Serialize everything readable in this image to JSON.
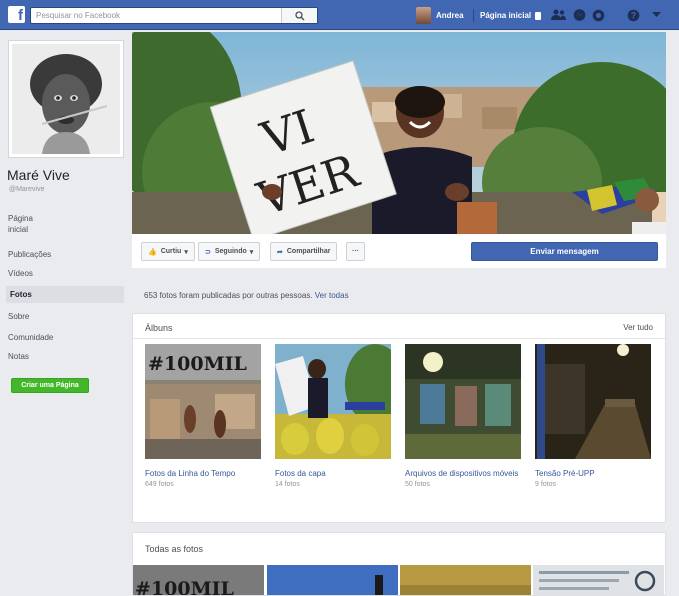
{
  "topbar": {
    "search_placeholder": "Pesquisar no Facebook",
    "logo": "f",
    "user_name": "Andrea",
    "home_label": "Página inicial",
    "icons": [
      "friends-icon",
      "messages-icon",
      "notifications-icon",
      "help-icon",
      "dropdown-icon"
    ],
    "brand_color": "#4267b2"
  },
  "page": {
    "name": "Maré Vive",
    "handle": "@Marevive"
  },
  "nav": {
    "items": [
      {
        "label": "Página inicial"
      },
      {
        "label": "Publicações"
      },
      {
        "label": "Vídeos"
      },
      {
        "label": "Fotos",
        "active": true
      },
      {
        "label": "Sobre"
      },
      {
        "label": "Comunidade"
      },
      {
        "label": "Notas"
      }
    ],
    "create_page_label": "Criar uma Página"
  },
  "cover": {
    "sign_text_line1": "VI",
    "sign_text_line2": "VER"
  },
  "actions": {
    "like_label": "Curtiu",
    "follow_label": "Seguindo",
    "share_label": "Compartilhar",
    "more_label": "···",
    "message_label": "Enviar mensagem"
  },
  "photos_info": {
    "text": "653 fotos foram publicadas por outras pessoas.",
    "link": "Ver todas"
  },
  "albums": {
    "title": "Álbuns",
    "see_all": "Ver tudo",
    "items": [
      {
        "name": "Fotos da Linha do Tempo",
        "count": "649 fotos",
        "overlay": "#100MIL"
      },
      {
        "name": "Fotos da capa",
        "count": "14 fotos"
      },
      {
        "name": "Arquivos de dispositivos móveis",
        "count": "50 fotos"
      },
      {
        "name": "Tensão Pré-UPP",
        "count": "9 fotos"
      }
    ]
  },
  "all_photos": {
    "title": "Todas as fotos",
    "first_overlay": "#100MIL"
  }
}
